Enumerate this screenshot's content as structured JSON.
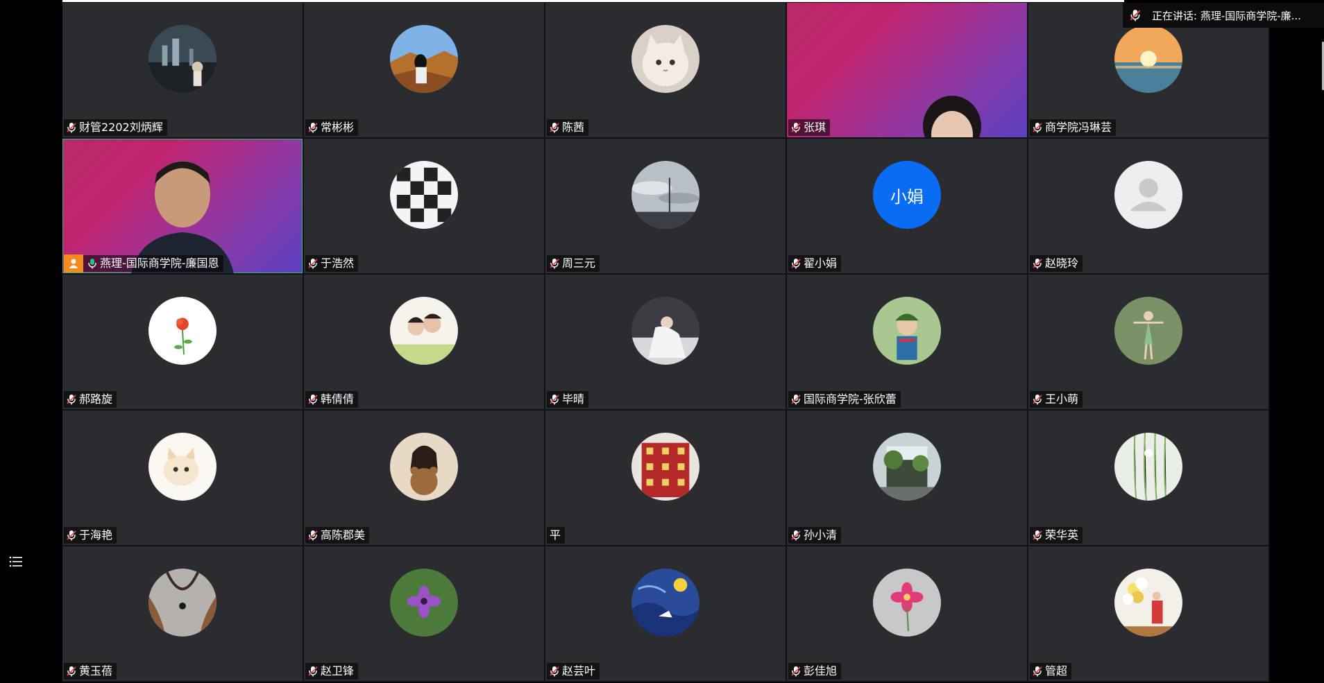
{
  "speaking": {
    "text": "正在讲话: 燕理-国际商学院-廉..."
  },
  "participants": [
    {
      "name": "财管2202刘炳辉",
      "mic": "muted",
      "avatar": "photo-city"
    },
    {
      "name": "常彬彬",
      "mic": "muted",
      "avatar": "photo-canyon"
    },
    {
      "name": "陈茜",
      "mic": "muted",
      "avatar": "photo-cat"
    },
    {
      "name": "张琪",
      "mic": "muted",
      "avatar": "video"
    },
    {
      "name": "商学院冯琳芸",
      "mic": "muted",
      "avatar": "photo-sunset"
    },
    {
      "name": "燕理-国际商学院-廉国恩",
      "mic": "active",
      "avatar": "video-host",
      "host": true
    },
    {
      "name": "于浩然",
      "mic": "muted",
      "avatar": "photo-checker"
    },
    {
      "name": "周三元",
      "mic": "muted",
      "avatar": "photo-sky"
    },
    {
      "name": "翟小娟",
      "mic": "muted",
      "avatar": "text",
      "avatar_text": "小娟",
      "avatar_color": "#0a6cf5"
    },
    {
      "name": "赵晓玲",
      "mic": "muted",
      "avatar": "default"
    },
    {
      "name": "郝路旋",
      "mic": "muted",
      "avatar": "photo-rose"
    },
    {
      "name": "韩倩倩",
      "mic": "muted",
      "avatar": "photo-couple"
    },
    {
      "name": "毕晴",
      "mic": "muted",
      "avatar": "photo-bride"
    },
    {
      "name": "国际商学院-张欣蕾",
      "mic": "muted",
      "avatar": "photo-child"
    },
    {
      "name": "王小萌",
      "mic": "muted",
      "avatar": "photo-dancer"
    },
    {
      "name": "于海艳",
      "mic": "muted",
      "avatar": "photo-kitten"
    },
    {
      "name": "高陈郡美",
      "mic": "muted",
      "avatar": "photo-girl-bear"
    },
    {
      "name": "平",
      "mic": "none",
      "avatar": "photo-building"
    },
    {
      "name": "孙小清",
      "mic": "muted",
      "avatar": "photo-garden"
    },
    {
      "name": "荣华英",
      "mic": "muted",
      "avatar": "photo-willow"
    },
    {
      "name": "黄玉蓓",
      "mic": "muted",
      "avatar": "photo-necklace"
    },
    {
      "name": "赵卫锋",
      "mic": "muted",
      "avatar": "photo-flower-purple"
    },
    {
      "name": "赵芸叶",
      "mic": "muted",
      "avatar": "photo-starry"
    },
    {
      "name": "彭佳旭",
      "mic": "muted",
      "avatar": "photo-flower-pink"
    },
    {
      "name": "管超",
      "mic": "muted",
      "avatar": "photo-balloons"
    }
  ],
  "colors": {
    "tile_bg": "#2a2c30",
    "host_badge": "#f28a1c",
    "mic_active": "#27c27a",
    "muted_red": "#e54848"
  }
}
